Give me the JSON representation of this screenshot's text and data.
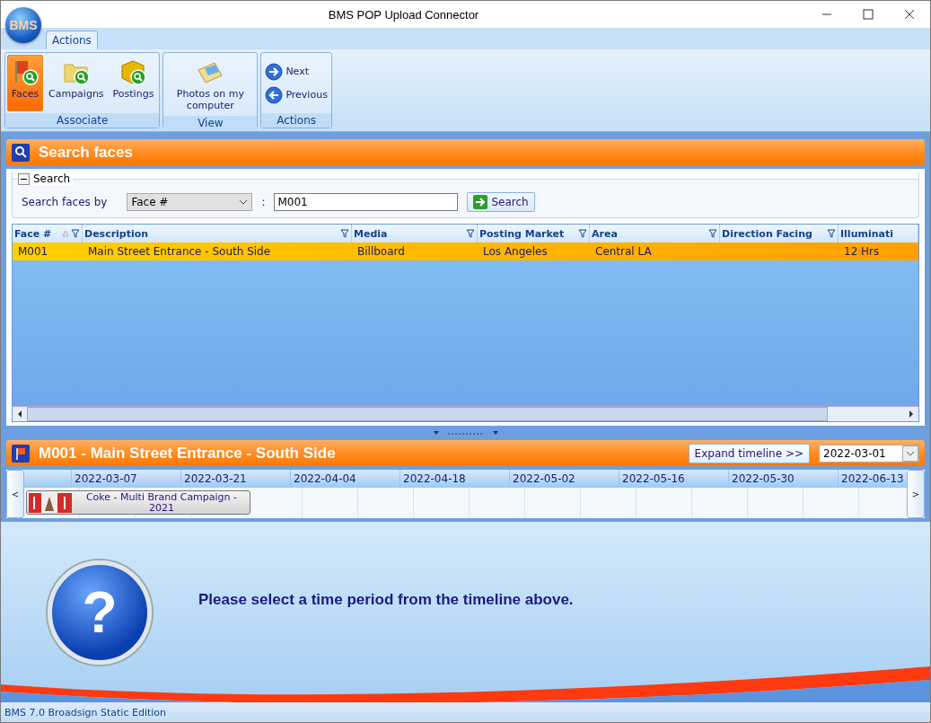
{
  "window": {
    "title": "BMS POP Upload Connector",
    "logo": "BMS"
  },
  "ribbon": {
    "tabs": [
      {
        "label": "Actions",
        "selected": true
      }
    ],
    "groups": [
      {
        "label": "Associate",
        "kind": "large",
        "buttons": [
          {
            "label": "Faces",
            "kind": "flag",
            "selected": true
          },
          {
            "label": "Campaigns",
            "kind": "folder",
            "selected": false
          },
          {
            "label": "Postings",
            "kind": "box",
            "selected": false
          }
        ]
      },
      {
        "label": "View",
        "kind": "large",
        "buttons": [
          {
            "label": "Photos on my computer",
            "kind": "photos",
            "selected": false
          }
        ]
      },
      {
        "label": "Actions",
        "kind": "small",
        "buttons": [
          {
            "label": "Next",
            "kind": "next",
            "selected": false
          },
          {
            "label": "Previous",
            "kind": "previous",
            "selected": false
          }
        ]
      }
    ]
  },
  "search_panel": {
    "title": "Search faces",
    "group": {
      "title": "Search",
      "expanded": true,
      "label": "Search faces by",
      "field": "Face #",
      "separator": ":",
      "query": "M001",
      "button": "Search"
    }
  },
  "grid": {
    "columns": [
      {
        "label": "Face #",
        "sorted": true
      },
      {
        "label": "Description",
        "sorted": false
      },
      {
        "label": "Media",
        "sorted": false
      },
      {
        "label": "Posting Market",
        "sorted": false
      },
      {
        "label": "Area",
        "sorted": false
      },
      {
        "label": "Direction Facing",
        "sorted": false
      },
      {
        "label": "Illuminati",
        "sorted": false
      }
    ],
    "rows": [
      {
        "selected": true,
        "cells": [
          "M001",
          "Main Street Entrance - South Side",
          "Billboard",
          "Los Angeles",
          "Central LA",
          "",
          "12 Hrs"
        ]
      }
    ]
  },
  "face_panel": {
    "title": "M001 - Main Street Entrance - South Side",
    "expand_button": "Expand timeline >>",
    "date": "2022-03-01",
    "timeline": {
      "prev": "<",
      "next": ">",
      "dates": [
        "2022-03-07",
        "2022-03-21",
        "2022-04-04",
        "2022-04-18",
        "2022-05-02",
        "2022-05-16",
        "2022-05-30",
        "2022-06-13"
      ],
      "bookings": [
        {
          "label": "Coke - Multi Brand Campaign - 2021"
        }
      ]
    }
  },
  "message": {
    "icon": "?",
    "text": "Please select a time period from the timeline above."
  },
  "status_bar": "BMS 7.0 Broadsign Static Edition"
}
